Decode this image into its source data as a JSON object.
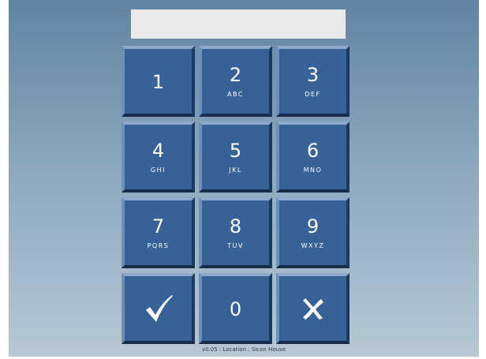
{
  "pin_input": {
    "value": "",
    "placeholder": ""
  },
  "keys": [
    {
      "digit": "1",
      "letters": ""
    },
    {
      "digit": "2",
      "letters": "ABC"
    },
    {
      "digit": "3",
      "letters": "DEF"
    },
    {
      "digit": "4",
      "letters": "GHI"
    },
    {
      "digit": "5",
      "letters": "JKL"
    },
    {
      "digit": "6",
      "letters": "MNO"
    },
    {
      "digit": "7",
      "letters": "PQRS"
    },
    {
      "digit": "8",
      "letters": "TUV"
    },
    {
      "digit": "9",
      "letters": "WXYZ"
    },
    {
      "digit": "0",
      "letters": ""
    }
  ],
  "actions": {
    "confirm_icon": "checkmark-icon",
    "cancel_icon": "x-icon"
  },
  "colors": {
    "key": "#2e5a93",
    "background_top": "#5b7f9f",
    "background_bottom": "#b5c6d2"
  },
  "footer": {
    "text": "v0.05 : Location : Sicon House"
  }
}
